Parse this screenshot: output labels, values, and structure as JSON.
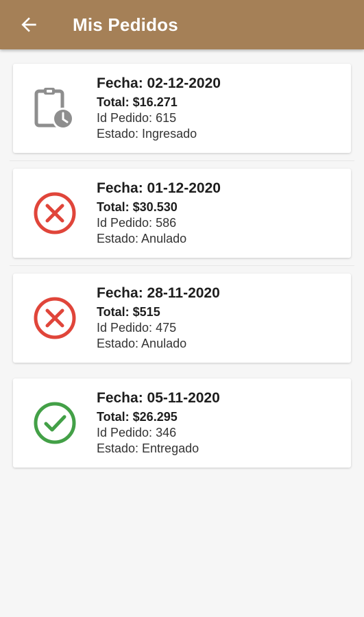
{
  "header": {
    "title": "Mis Pedidos",
    "back_icon": "arrow-left-icon"
  },
  "colors": {
    "appbar": "#a58057",
    "cancelled": "#e0453a",
    "delivered": "#43a047",
    "pending": "#8e8e8e"
  },
  "orders": [
    {
      "fecha": "Fecha: 02-12-2020",
      "total": "Total: $16.271",
      "id": "Id Pedido: 615",
      "estado": "Estado: Ingresado",
      "icon": "clipboard-clock-icon"
    },
    {
      "fecha": "Fecha: 01-12-2020",
      "total": "Total: $30.530",
      "id": "Id Pedido: 586",
      "estado": "Estado: Anulado",
      "icon": "cancel-circle-icon"
    },
    {
      "fecha": "Fecha: 28-11-2020",
      "total": "Total: $515",
      "id": "Id Pedido: 475",
      "estado": "Estado: Anulado",
      "icon": "cancel-circle-icon"
    },
    {
      "fecha": "Fecha: 05-11-2020",
      "total": "Total: $26.295",
      "id": "Id Pedido: 346",
      "estado": "Estado: Entregado",
      "icon": "check-circle-icon"
    }
  ]
}
